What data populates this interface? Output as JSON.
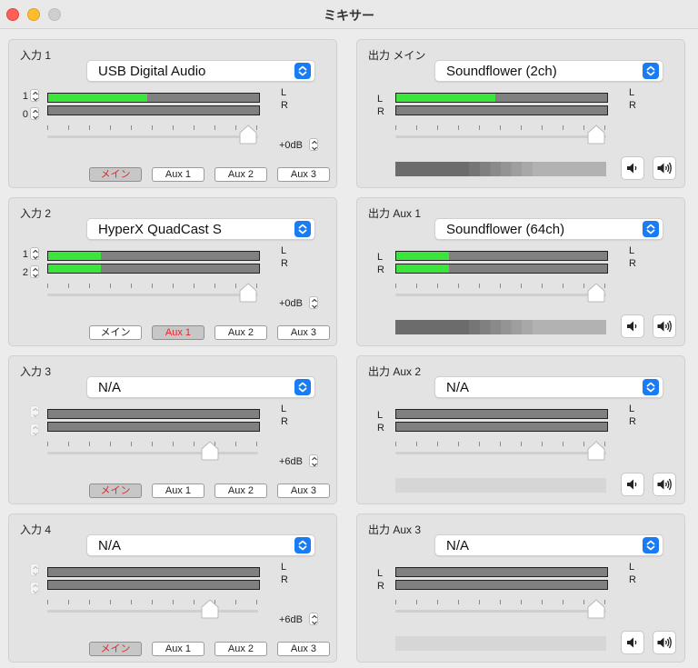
{
  "window": {
    "title": "ミキサー"
  },
  "colors": {
    "meter_fill": "#3ce53c",
    "active_route_text": "#e8252a",
    "dropdown_accent": "#1a7cf5"
  },
  "icons": {
    "dropdown": "chevron-up-down-icon",
    "mute": "speaker-low-icon",
    "unmute": "speaker-high-icon"
  },
  "inputs": [
    {
      "label": "入力 1",
      "device": "USB Digital Audio",
      "channel_l": "1",
      "channel_r": "0",
      "level_l": 0.47,
      "level_r": 0,
      "gain": "+0dB",
      "gain_pos": 1.0,
      "routes": [
        {
          "label": "メイン",
          "active": true
        },
        {
          "label": "Aux 1",
          "active": false
        },
        {
          "label": "Aux 2",
          "active": false
        },
        {
          "label": "Aux 3",
          "active": false
        }
      ]
    },
    {
      "label": "入力 2",
      "device": "HyperX QuadCast S",
      "channel_l": "1",
      "channel_r": "2",
      "level_l": 0.25,
      "level_r": 0.25,
      "gain": "+0dB",
      "gain_pos": 1.0,
      "routes": [
        {
          "label": "メイン",
          "active": false
        },
        {
          "label": "Aux 1",
          "active": true
        },
        {
          "label": "Aux 2",
          "active": false
        },
        {
          "label": "Aux 3",
          "active": false
        }
      ]
    },
    {
      "label": "入力 3",
      "device": "N/A",
      "channel_l": "",
      "channel_r": "",
      "level_l": 0,
      "level_r": 0,
      "gain": "+6dB",
      "gain_pos": 0.81,
      "routes": [
        {
          "label": "メイン",
          "active": true
        },
        {
          "label": "Aux 1",
          "active": false
        },
        {
          "label": "Aux 2",
          "active": false
        },
        {
          "label": "Aux 3",
          "active": false
        }
      ]
    },
    {
      "label": "入力 4",
      "device": "N/A",
      "channel_l": "",
      "channel_r": "",
      "level_l": 0,
      "level_r": 0,
      "gain": "+6dB",
      "gain_pos": 0.81,
      "routes": [
        {
          "label": "メイン",
          "active": true
        },
        {
          "label": "Aux 1",
          "active": false
        },
        {
          "label": "Aux 2",
          "active": false
        },
        {
          "label": "Aux 3",
          "active": false
        }
      ]
    }
  ],
  "outputs": [
    {
      "label": "出力 メイン",
      "device": "Soundflower (2ch)",
      "level_l": 0.47,
      "level_r": 0,
      "volume_pos": 1.0,
      "has_signal": true
    },
    {
      "label": "出力 Aux 1",
      "device": "Soundflower (64ch)",
      "level_l": 0.25,
      "level_r": 0.25,
      "volume_pos": 1.0,
      "has_signal": true
    },
    {
      "label": "出力 Aux 2",
      "device": "N/A",
      "level_l": 0,
      "level_r": 0,
      "volume_pos": 1.0,
      "has_signal": false
    },
    {
      "label": "出力 Aux 3",
      "device": "N/A",
      "level_l": 0,
      "level_r": 0,
      "volume_pos": 1.0,
      "has_signal": false
    }
  ],
  "channel_labels": {
    "left": "L",
    "right": "R"
  }
}
